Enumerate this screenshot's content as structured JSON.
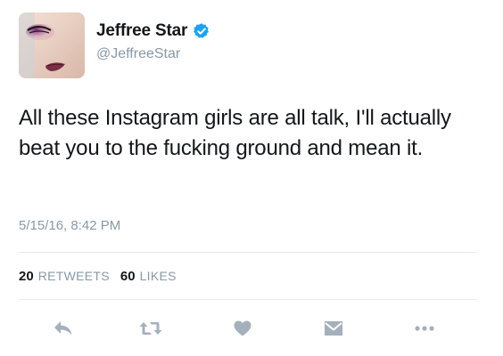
{
  "author": {
    "display_name": "Jeffree Star",
    "handle": "@JeffreeStar",
    "verified": true
  },
  "tweet": {
    "text": "All these Instagram girls are all talk, I'll actually beat you to the fucking ground and mean it.",
    "timestamp": "5/15/16, 8:42 PM"
  },
  "stats": {
    "retweets_count": "20",
    "retweets_label": "RETWEETS",
    "likes_count": "60",
    "likes_label": "LIKES"
  },
  "actions": [
    "reply-icon",
    "retweet-icon",
    "heart-icon",
    "direct-message-icon",
    "more-icon"
  ],
  "colors": {
    "text": "#14171a",
    "secondary": "#8899a6",
    "verified_blue": "#1da1f2",
    "icon_gray": "#a4b0bb",
    "divider": "#e6ecf0"
  }
}
